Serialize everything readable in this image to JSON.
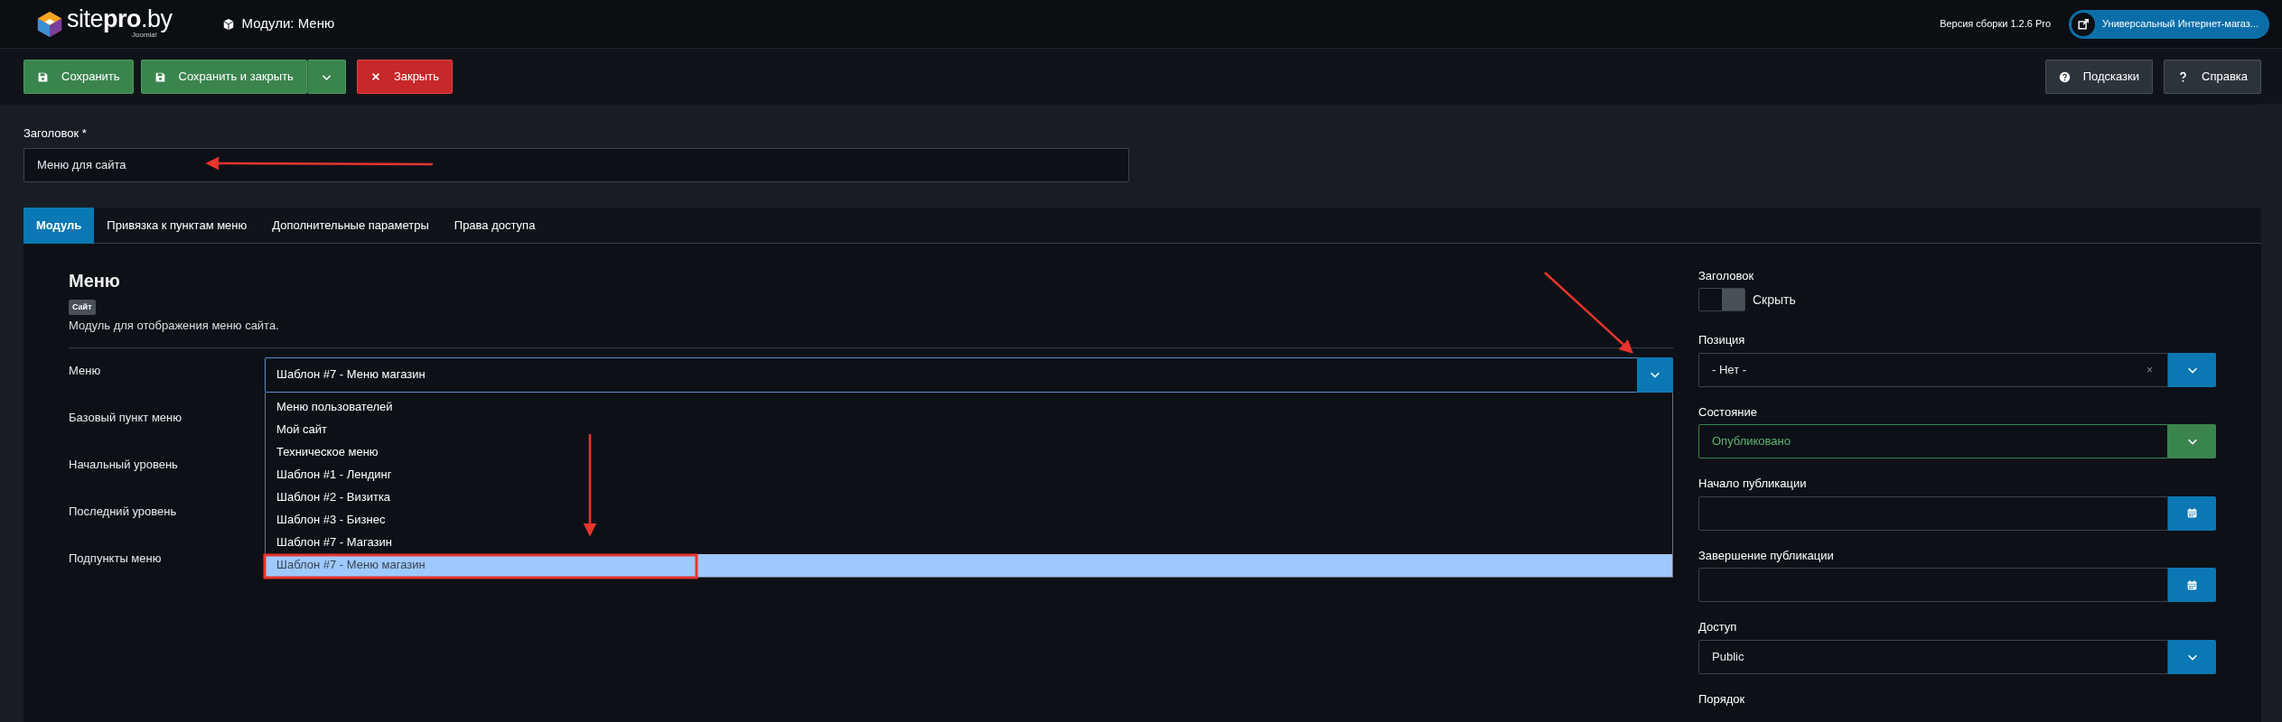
{
  "header": {
    "logo": "site**pro**.by",
    "logo_sub": "Joomla!",
    "title": "Модули: Меню",
    "version": "Версия сборки 1.2.6 Pro",
    "site_link": "Универсальный Интернет-магаз..."
  },
  "toolbar": {
    "left": [
      {
        "kind": "save",
        "label": "Сохранить"
      },
      {
        "kind": "save-split",
        "label": "Сохранить и закрыть"
      },
      {
        "kind": "close",
        "label": "Закрыть"
      }
    ],
    "right": [
      {
        "kind": "tips",
        "label": "Подсказки"
      },
      {
        "kind": "help",
        "label": "Справка"
      }
    ]
  },
  "title_field": {
    "label": "Заголовок *",
    "value": "Меню для сайта"
  },
  "tabs": [
    {
      "label": "Модуль",
      "selected": true
    },
    {
      "label": "Привязка к пунктам меню",
      "selected": false
    },
    {
      "label": "Дополнительные параметры",
      "selected": false
    },
    {
      "label": "Права доступа",
      "selected": false
    }
  ],
  "module": {
    "heading": "Меню",
    "badge": "Сайт",
    "description": "Модуль для отображения меню сайта."
  },
  "left_fields": [
    {
      "kind": "select",
      "label": "Меню",
      "value": "Шаблон #7 - Меню магазин",
      "expanded": true,
      "options": [
        {
          "label": "Меню пользователей",
          "selected": false
        },
        {
          "label": "Мой сайт",
          "selected": false
        },
        {
          "label": "Техническое меню",
          "selected": false
        },
        {
          "label": "Шаблон #1 - Лендинг",
          "selected": false
        },
        {
          "label": "Шаблон #2 - Визитка",
          "selected": false
        },
        {
          "label": "Шаблон #3 - Бизнес",
          "selected": false
        },
        {
          "label": "Шаблон #7 - Магазин",
          "selected": false
        },
        {
          "label": "Шаблон #7 - Меню магазин",
          "selected": true
        }
      ]
    },
    {
      "kind": "covered",
      "label": "Базовый пункт меню"
    },
    {
      "kind": "covered",
      "label": "Начальный уровень"
    },
    {
      "kind": "covered",
      "label": "Последний уровень"
    },
    {
      "kind": "covered",
      "label": "Подпункты меню"
    }
  ],
  "right_fields": [
    {
      "kind": "toggle",
      "label": "Заголовок",
      "toggle_label": "Скрыть",
      "on": false
    },
    {
      "kind": "select",
      "label": "Позиция",
      "value": "- Нет -",
      "clear": "×"
    },
    {
      "kind": "status",
      "label": "Состояние",
      "value": "Опубликовано"
    },
    {
      "kind": "date",
      "label": "Начало публикации"
    },
    {
      "kind": "date",
      "label": "Завершение публикации"
    },
    {
      "kind": "select",
      "label": "Доступ",
      "value": "Public"
    },
    {
      "kind": "label",
      "label": "Порядок"
    }
  ]
}
